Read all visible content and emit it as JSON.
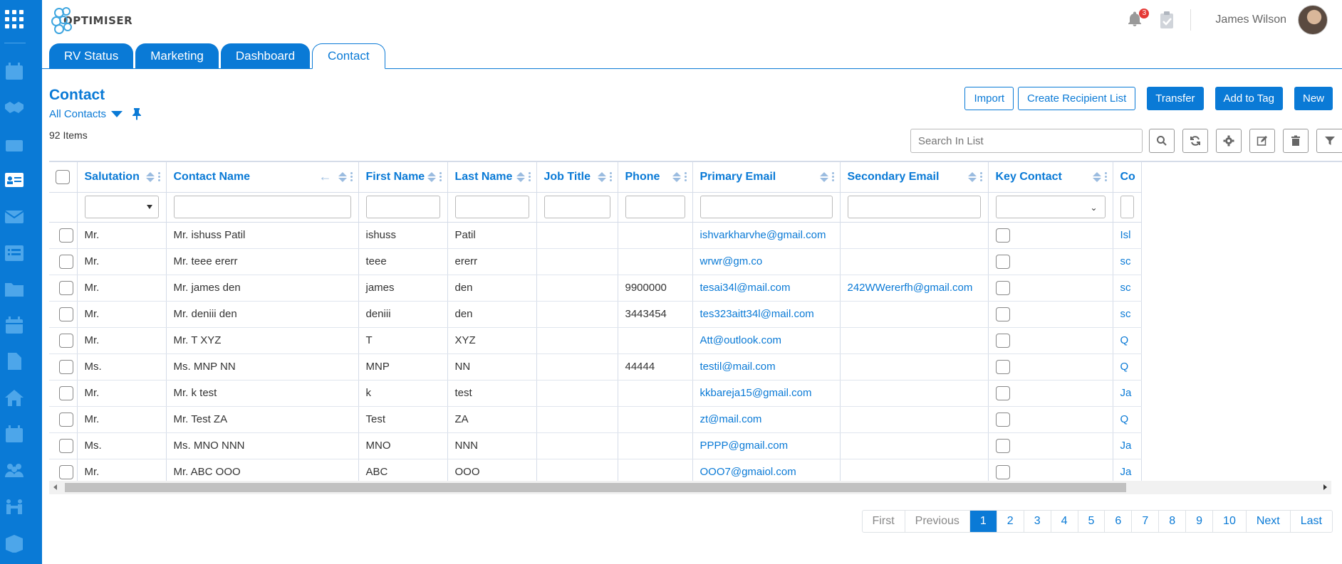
{
  "app": {
    "logo_text": "OPTIMISER"
  },
  "header": {
    "notification_count": "3",
    "user_name": "James Wilson"
  },
  "sidebar": {
    "items": [
      {
        "icon": "calendar-icon"
      },
      {
        "icon": "handshake-icon"
      },
      {
        "icon": "briefcase-icon"
      },
      {
        "icon": "contact-card-icon",
        "active": true
      },
      {
        "icon": "envelope-icon"
      },
      {
        "icon": "list-icon"
      },
      {
        "icon": "folder-icon"
      },
      {
        "icon": "calendar-alt-icon"
      },
      {
        "icon": "document-icon"
      },
      {
        "icon": "home-icon"
      },
      {
        "icon": "calendar-event-icon"
      },
      {
        "icon": "users-icon"
      },
      {
        "icon": "people-group-icon"
      },
      {
        "icon": "box-icon"
      }
    ]
  },
  "tabs": [
    {
      "label": "RV Status",
      "active": false
    },
    {
      "label": "Marketing",
      "active": false
    },
    {
      "label": "Dashboard",
      "active": false
    },
    {
      "label": "Contact",
      "active": true
    }
  ],
  "page": {
    "title": "Contact",
    "view": "All Contacts",
    "items_count": "92 Items"
  },
  "actions": {
    "import": "Import",
    "create_recipient_list": "Create Recipient List",
    "transfer": "Transfer",
    "add_to_tag": "Add to Tag",
    "new": "New"
  },
  "search": {
    "placeholder": "Search In List"
  },
  "table": {
    "columns": [
      "Salutation",
      "Contact Name",
      "First Name",
      "Last Name",
      "Job Title",
      "Phone",
      "Primary Email",
      "Secondary Email",
      "Key Contact",
      "Co"
    ],
    "rows": [
      {
        "salutation": "Mr.",
        "contact_name": "Mr. ishuss Patil",
        "first_name": "ishuss",
        "last_name": "Patil",
        "job_title": "",
        "phone": "",
        "primary_email": "ishvarkharvhe@gmail.com",
        "secondary_email": "",
        "company": "Isl"
      },
      {
        "salutation": "Mr.",
        "contact_name": "Mr. teee ererr",
        "first_name": "teee",
        "last_name": "ererr",
        "job_title": "",
        "phone": "",
        "primary_email": "wrwr@gm.co",
        "secondary_email": "",
        "company": "sc"
      },
      {
        "salutation": "Mr.",
        "contact_name": "Mr. james den",
        "first_name": "james",
        "last_name": "den",
        "job_title": "",
        "phone": "9900000",
        "primary_email": "tesai34l@mail.com",
        "secondary_email": "242WWererfh@gmail.com",
        "company": "sc"
      },
      {
        "salutation": "Mr.",
        "contact_name": "Mr. deniii den",
        "first_name": "deniii",
        "last_name": "den",
        "job_title": "",
        "phone": "3443454",
        "primary_email": "tes323aitt34l@mail.com",
        "secondary_email": "",
        "company": "sc"
      },
      {
        "salutation": "Mr.",
        "contact_name": "Mr. T XYZ",
        "first_name": "T",
        "last_name": "XYZ",
        "job_title": "",
        "phone": "",
        "primary_email": "Att@outlook.com",
        "secondary_email": "",
        "company": "Q"
      },
      {
        "salutation": "Ms.",
        "contact_name": "Ms. MNP NN",
        "first_name": "MNP",
        "last_name": "NN",
        "job_title": "",
        "phone": "44444",
        "primary_email": "testil@mail.com",
        "secondary_email": "",
        "company": "Q"
      },
      {
        "salutation": "Mr.",
        "contact_name": "Mr. k test",
        "first_name": "k",
        "last_name": "test",
        "job_title": "",
        "phone": "",
        "primary_email": "kkbareja15@gmail.com",
        "secondary_email": "",
        "company": "Ja"
      },
      {
        "salutation": "Mr.",
        "contact_name": "Mr. Test ZA",
        "first_name": "Test",
        "last_name": "ZA",
        "job_title": "",
        "phone": "",
        "primary_email": "zt@mail.com",
        "secondary_email": "",
        "company": "Q"
      },
      {
        "salutation": "Ms.",
        "contact_name": "Ms. MNO NNN",
        "first_name": "MNO",
        "last_name": "NNN",
        "job_title": "",
        "phone": "",
        "primary_email": "PPPP@gmail.com",
        "secondary_email": "",
        "company": "Ja"
      },
      {
        "salutation": "Mr.",
        "contact_name": "Mr. ABC OOO",
        "first_name": "ABC",
        "last_name": "OOO",
        "job_title": "",
        "phone": "",
        "primary_email": "OOO7@gmaiol.com",
        "secondary_email": "",
        "company": "Ja"
      }
    ]
  },
  "pagination": {
    "first": "First",
    "previous": "Previous",
    "pages": [
      "1",
      "2",
      "3",
      "4",
      "5",
      "6",
      "7",
      "8",
      "9",
      "10"
    ],
    "current": "1",
    "next": "Next",
    "last": "Last"
  },
  "colors": {
    "accent": "#0a7ad6",
    "sidebar": "#0a7ad6",
    "badge": "#e53935"
  }
}
